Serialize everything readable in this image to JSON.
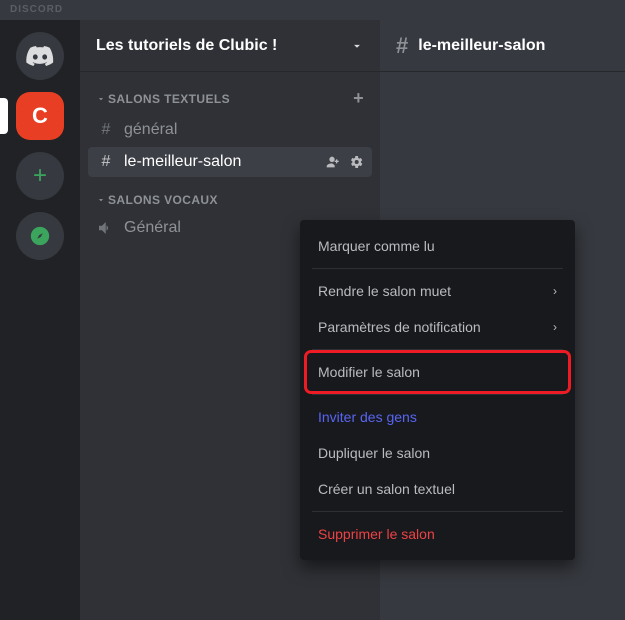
{
  "app_label": "DISCORD",
  "server_header": {
    "title": "Les tutoriels de Clubic !"
  },
  "chat_header": {
    "channel": "le-meilleur-salon"
  },
  "categories": {
    "text": {
      "label": "SALONS TEXTUELS"
    },
    "voice": {
      "label": "SALONS VOCAUX"
    }
  },
  "channels": {
    "general": "général",
    "best": "le-meilleur-salon",
    "voice_general": "Général"
  },
  "context_menu": {
    "mark_read": "Marquer comme lu",
    "mute": "Rendre le salon muet",
    "notif": "Paramètres de notification",
    "edit": "Modifier le salon",
    "invite": "Inviter des gens",
    "clone": "Dupliquer le salon",
    "create": "Créer un salon textuel",
    "delete": "Supprimer le salon"
  },
  "clubic_letter": "C"
}
